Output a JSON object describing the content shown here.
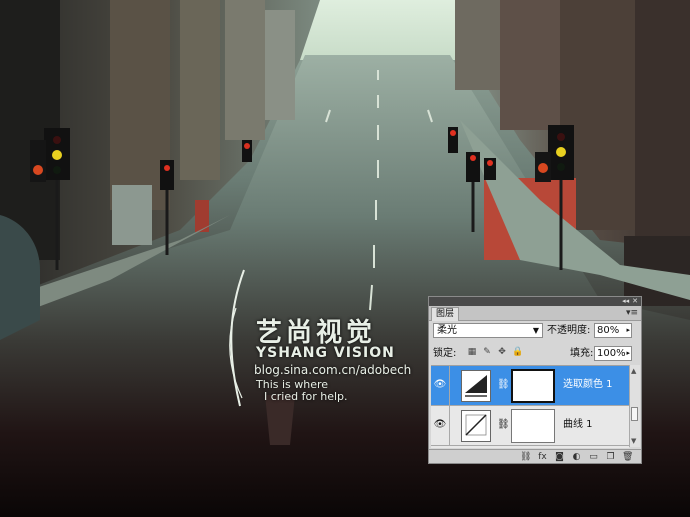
{
  "watermark": {
    "chinese": "艺尚视觉",
    "english": "YSHANG VISION",
    "url": "blog.sina.com.cn/adobech",
    "line1": "This is where",
    "line2": "I cried for help."
  },
  "layers_panel": {
    "tab_label": "图层",
    "blend_mode": "柔光",
    "opacity_label": "不透明度:",
    "opacity_value": "80%",
    "lock_label": "锁定:",
    "fill_label": "填充:",
    "fill_value": "100%",
    "layers": [
      {
        "name": "选取颜色 1",
        "selected": true
      },
      {
        "name": "曲线 1",
        "selected": false
      }
    ]
  },
  "colors": {
    "selection": "#3c8fe6",
    "panel_bg": "#d6d6d6"
  }
}
